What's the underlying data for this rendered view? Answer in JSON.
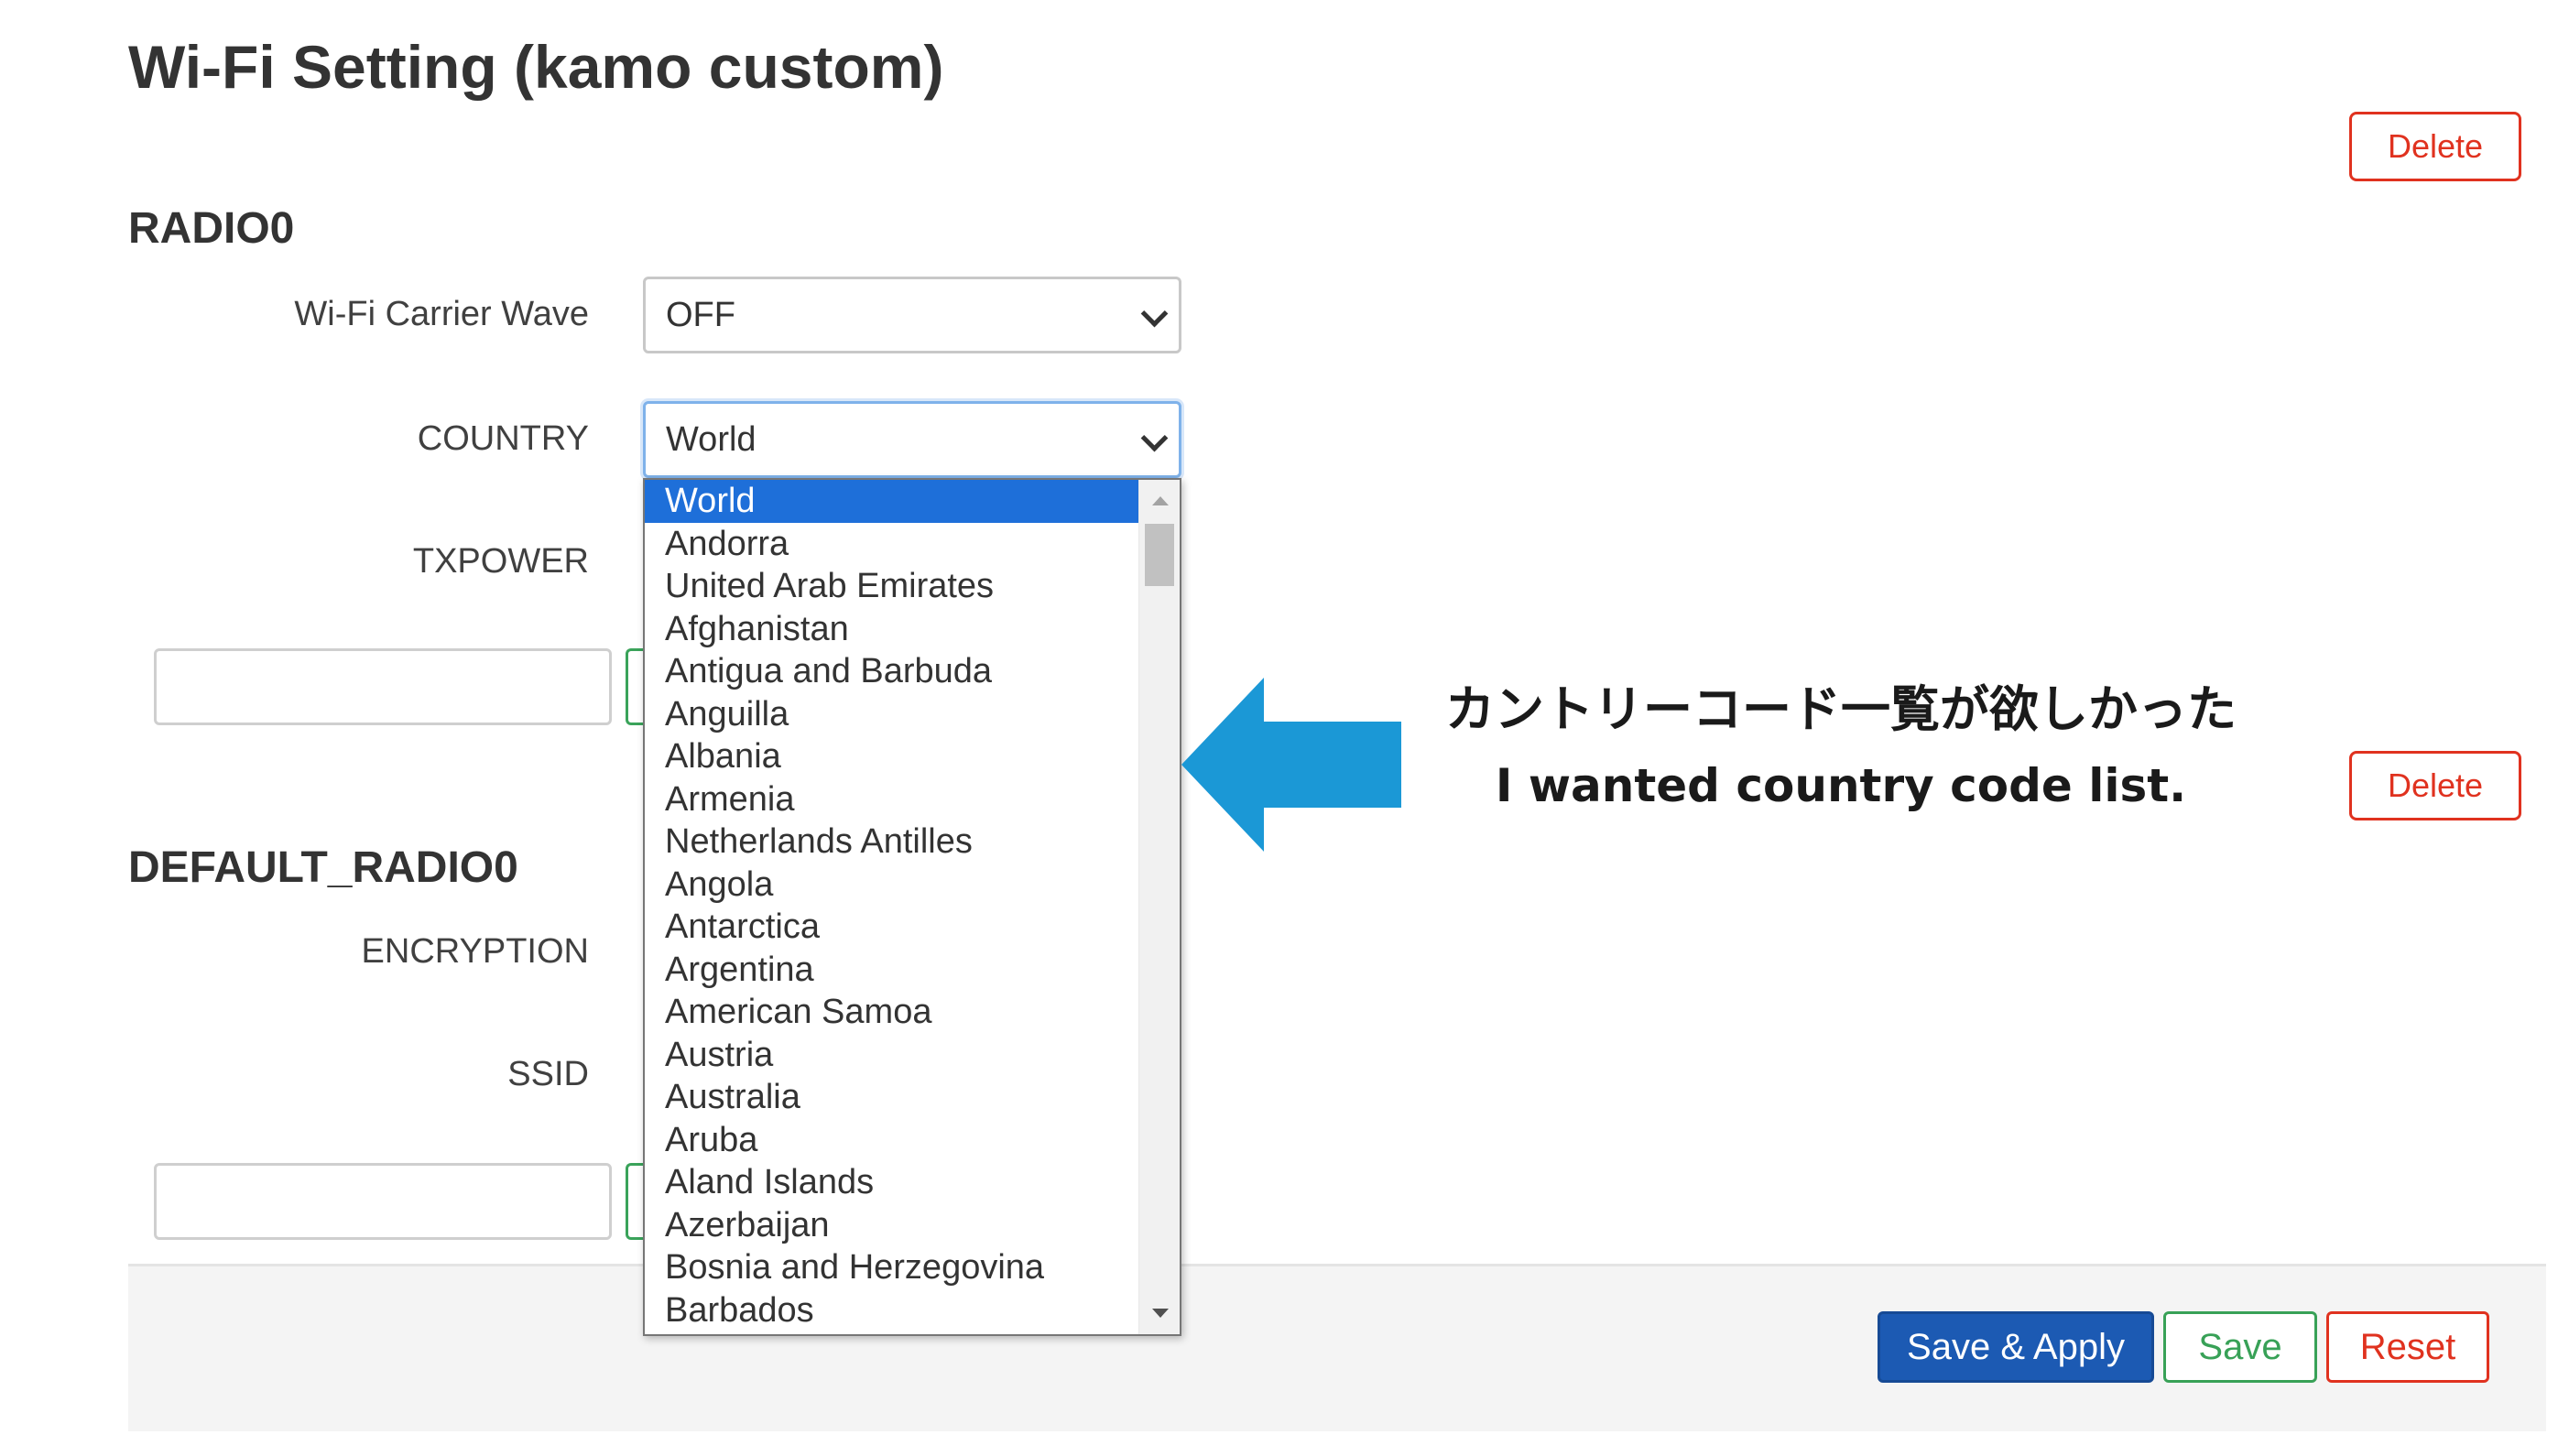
{
  "page": {
    "title": "Wi-Fi Setting (kamo custom)"
  },
  "radio0": {
    "section_title": "RADIO0",
    "delete_label": "Delete",
    "carrier_wave_label": "Wi-Fi Carrier Wave",
    "carrier_wave_value": "OFF",
    "country_label": "COUNTRY",
    "country_value": "World",
    "txpower_label": "TXPOWER"
  },
  "default_radio0": {
    "section_title": "DEFAULT_RADIO0",
    "delete_label": "Delete",
    "encryption_label": "ENCRYPTION",
    "ssid_label": "SSID"
  },
  "country_dropdown": {
    "selected": "World",
    "options": [
      "World",
      "Andorra",
      "United Arab Emirates",
      "Afghanistan",
      "Antigua and Barbuda",
      "Anguilla",
      "Albania",
      "Armenia",
      "Netherlands Antilles",
      "Angola",
      "Antarctica",
      "Argentina",
      "American Samoa",
      "Austria",
      "Australia",
      "Aruba",
      "Aland Islands",
      "Azerbaijan",
      "Bosnia and Herzegovina",
      "Barbados"
    ]
  },
  "footer": {
    "save_apply_label": "Save & Apply",
    "save_label": "Save",
    "reset_label": "Reset"
  },
  "annotation": {
    "japanese": "カントリーコード一覧が欲しかった",
    "english": "I wanted country code list.",
    "arrow_color": "#1b98d6"
  },
  "colors": {
    "primary": "#1c5ab3",
    "success": "#38a157",
    "danger": "#e0321f",
    "selected_option": "#1e6fd9"
  }
}
